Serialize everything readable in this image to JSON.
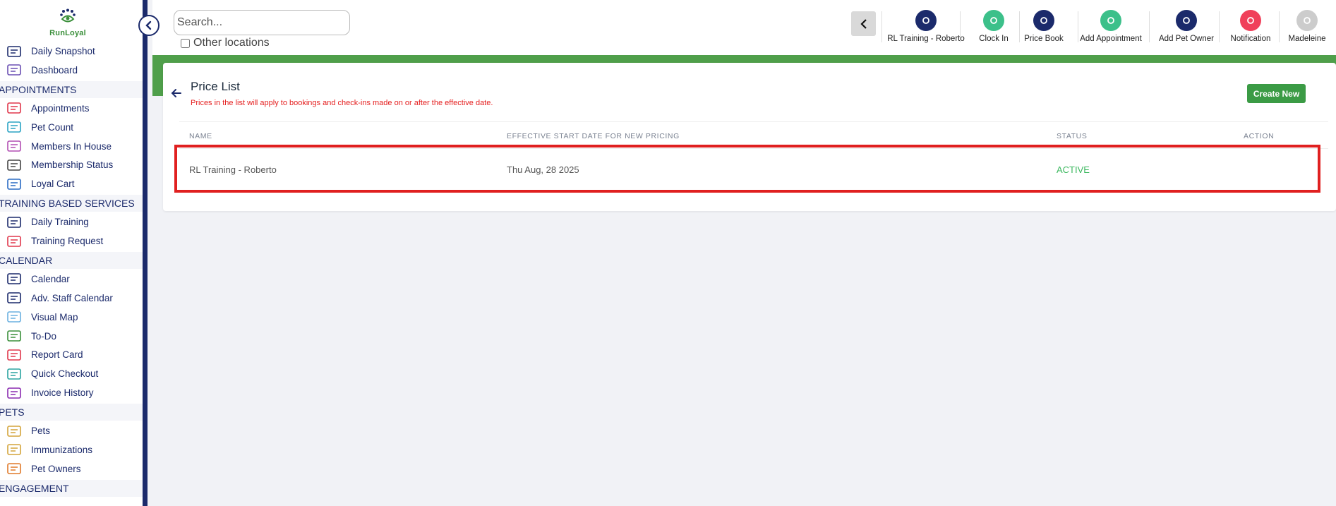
{
  "brand": {
    "name": "RunLoyal"
  },
  "colors": {
    "navy": "#1b2a6b",
    "green": "#4f9f4a",
    "accent_red": "#e02020",
    "active": "#3cb85f"
  },
  "sidebar": {
    "items": [
      {
        "type": "item",
        "label": "Daily Snapshot",
        "icon": "today-icon"
      },
      {
        "type": "item",
        "label": "Dashboard",
        "icon": "dashboard-icon"
      },
      {
        "type": "section",
        "label": "APPOINTMENTS"
      },
      {
        "type": "item",
        "label": "Appointments",
        "icon": "calendar-grid-icon"
      },
      {
        "type": "item",
        "label": "Pet Count",
        "icon": "paw-icon"
      },
      {
        "type": "item",
        "label": "Members In House",
        "icon": "house-icon"
      },
      {
        "type": "item",
        "label": "Membership Status",
        "icon": "list-people-icon"
      },
      {
        "type": "item",
        "label": "Loyal Cart",
        "icon": "cart-icon"
      },
      {
        "type": "section",
        "label": "TRAINING BASED SERVICES"
      },
      {
        "type": "item",
        "label": "Daily Training",
        "icon": "training-today-icon"
      },
      {
        "type": "item",
        "label": "Training Request",
        "icon": "training-request-icon"
      },
      {
        "type": "section",
        "label": "CALENDAR"
      },
      {
        "type": "item",
        "label": "Calendar",
        "icon": "calendar-icon"
      },
      {
        "type": "item",
        "label": "Adv. Staff Calendar",
        "icon": "staff-calendar-icon"
      },
      {
        "type": "item",
        "label": "Visual Map",
        "icon": "map-grid-icon"
      },
      {
        "type": "item",
        "label": "To-Do",
        "icon": "todo-icon"
      },
      {
        "type": "item",
        "label": "Report Card",
        "icon": "report-card-icon"
      },
      {
        "type": "item",
        "label": "Quick Checkout",
        "icon": "checkout-cart-icon"
      },
      {
        "type": "item",
        "label": "Invoice History",
        "icon": "invoice-history-icon"
      },
      {
        "type": "section",
        "label": "PETS"
      },
      {
        "type": "item",
        "label": "Pets",
        "icon": "paw-icon"
      },
      {
        "type": "item",
        "label": "Immunizations",
        "icon": "shield-icon"
      },
      {
        "type": "item",
        "label": "Pet Owners",
        "icon": "person-icon"
      },
      {
        "type": "section",
        "label": "ENGAGEMENT"
      }
    ]
  },
  "search": {
    "placeholder": "Search...",
    "other_locations_label": "Other locations"
  },
  "toolbar": {
    "items": [
      {
        "label": "RL Training - Roberto",
        "icon": "location-pin-icon",
        "color": "#1b2a6b"
      },
      {
        "label": "Clock In",
        "icon": "clock-icon",
        "color": "#3cc08a"
      },
      {
        "label": "Price Book",
        "icon": "document-icon",
        "color": "#1b2a6b"
      },
      {
        "label": "Add Appointment",
        "icon": "add-calendar-icon",
        "color": "#3cc08a"
      },
      {
        "label": "Add Pet Owner",
        "icon": "add-person-icon",
        "color": "#1b2a6b"
      },
      {
        "label": "Notification",
        "icon": "bell-icon",
        "color": "#f0405a"
      },
      {
        "label": "Madeleine",
        "icon": "avatar-icon",
        "color": "#cccccc"
      }
    ]
  },
  "page": {
    "title": "Price List",
    "subtitle": "Prices in the list will apply to bookings and check-ins made on or after the effective date.",
    "create_button": "Create New"
  },
  "table": {
    "columns": [
      "NAME",
      "EFFECTIVE START DATE FOR NEW PRICING",
      "STATUS",
      "ACTION"
    ],
    "rows": [
      {
        "name": "RL Training - Roberto",
        "date": "Thu Aug, 28 2025",
        "status": "ACTIVE",
        "action": ""
      }
    ]
  }
}
